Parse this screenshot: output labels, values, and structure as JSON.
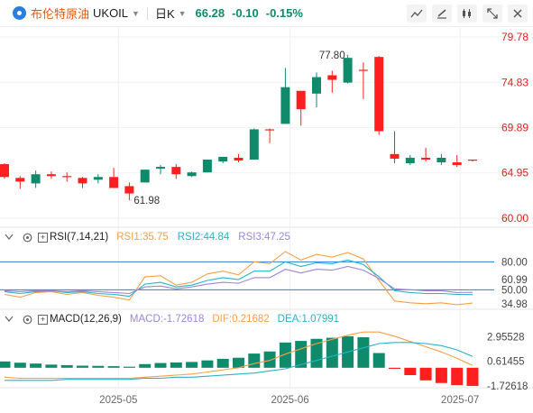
{
  "instrument": {
    "name_cn": "布伦特原油",
    "symbol": "UKOIL",
    "interval": "日K",
    "last_price": "66.28",
    "change": "-0.10",
    "change_pct": "-0.15%"
  },
  "toolbar_icons": [
    "indicator-icon",
    "draw-icon",
    "candle-type-icon",
    "fullscreen-icon",
    "close-icon"
  ],
  "colors": {
    "up": "#0f8a6b",
    "down": "#ff1f1f",
    "rsi1": "#f5a048",
    "rsi2": "#26b3c6",
    "rsi3": "#9b86d8",
    "macd": "#9b86d8",
    "dif": "#f5a048",
    "dea": "#26b3c6",
    "title_accent": "#e8570e"
  },
  "price_axis": {
    "labels": [
      "79.78",
      "74.83",
      "69.89",
      "64.95",
      "60.00"
    ]
  },
  "annotations": {
    "high": "77.80",
    "low": "61.98"
  },
  "rsi": {
    "label": "RSI(7,14,21)",
    "rsi1": "RSI1:35.75",
    "rsi2": "RSI2:44.84",
    "rsi3": "RSI3:47.25",
    "axis_labels": [
      "80.00",
      "60.99",
      "50.00",
      "34.98"
    ]
  },
  "macd": {
    "label": "MACD(12,26,9)",
    "macd": "MACD:-1.72618",
    "dif": "DIF:0.21682",
    "dea": "DEA:1.07991",
    "axis_labels": [
      "2.95528",
      "0.61455",
      "-1.72618"
    ]
  },
  "x_axis": {
    "labels": [
      "2025-05",
      "2025-06",
      "2025-07"
    ]
  },
  "chart_data": [
    {
      "type": "candlestick",
      "title": "UKOIL 日K",
      "ylim": [
        60.0,
        79.78
      ],
      "candles": [
        {
          "o": 65.9,
          "h": 66.0,
          "l": 64.3,
          "c": 64.5
        },
        {
          "o": 64.4,
          "h": 64.6,
          "l": 63.2,
          "c": 64.0
        },
        {
          "o": 63.8,
          "h": 65.2,
          "l": 63.3,
          "c": 64.8
        },
        {
          "o": 64.8,
          "h": 65.1,
          "l": 64.3,
          "c": 64.6
        },
        {
          "o": 64.6,
          "h": 65.0,
          "l": 64.0,
          "c": 64.5
        },
        {
          "o": 64.4,
          "h": 64.5,
          "l": 63.3,
          "c": 63.8
        },
        {
          "o": 64.2,
          "h": 64.8,
          "l": 63.8,
          "c": 64.5
        },
        {
          "o": 64.5,
          "h": 65.5,
          "l": 63.5,
          "c": 63.3
        },
        {
          "o": 63.5,
          "h": 63.9,
          "l": 61.98,
          "c": 62.7
        },
        {
          "o": 63.9,
          "h": 65.3,
          "l": 63.9,
          "c": 65.3
        },
        {
          "o": 65.4,
          "h": 65.8,
          "l": 64.8,
          "c": 65.6
        },
        {
          "o": 65.6,
          "h": 65.9,
          "l": 64.3,
          "c": 64.8
        },
        {
          "o": 64.6,
          "h": 65.1,
          "l": 64.5,
          "c": 65.0
        },
        {
          "o": 65.0,
          "h": 66.4,
          "l": 65.0,
          "c": 66.4
        },
        {
          "o": 66.2,
          "h": 66.7,
          "l": 66.0,
          "c": 66.7
        },
        {
          "o": 66.6,
          "h": 67.0,
          "l": 66.1,
          "c": 66.3
        },
        {
          "o": 66.4,
          "h": 69.8,
          "l": 66.4,
          "c": 69.7
        },
        {
          "o": 69.7,
          "h": 69.8,
          "l": 68.2,
          "c": 69.6
        },
        {
          "o": 70.3,
          "h": 76.4,
          "l": 70.3,
          "c": 74.3
        },
        {
          "o": 73.9,
          "h": 73.9,
          "l": 70.1,
          "c": 71.9
        },
        {
          "o": 73.6,
          "h": 75.9,
          "l": 72.1,
          "c": 75.4
        },
        {
          "o": 75.6,
          "h": 76.1,
          "l": 73.7,
          "c": 75.1
        },
        {
          "o": 74.8,
          "h": 77.8,
          "l": 74.7,
          "c": 77.5
        },
        {
          "o": 76.2,
          "h": 77.0,
          "l": 73.0,
          "c": 76.1
        },
        {
          "o": 77.6,
          "h": 77.7,
          "l": 69.1,
          "c": 69.5
        },
        {
          "o": 67.0,
          "h": 69.5,
          "l": 66.0,
          "c": 66.5
        },
        {
          "o": 66.0,
          "h": 66.9,
          "l": 65.8,
          "c": 66.6
        },
        {
          "o": 66.6,
          "h": 67.7,
          "l": 66.2,
          "c": 66.4
        },
        {
          "o": 66.1,
          "h": 67.0,
          "l": 65.8,
          "c": 66.6
        },
        {
          "o": 66.1,
          "h": 66.9,
          "l": 65.6,
          "c": 65.8
        },
        {
          "o": 66.4,
          "h": 66.4,
          "l": 66.2,
          "c": 66.28
        }
      ]
    },
    {
      "type": "line",
      "title": "RSI(7,14,21)",
      "ylim": [
        30,
        90
      ],
      "reference_lines": [
        80,
        50
      ],
      "series": [
        {
          "name": "RSI1",
          "values": [
            45,
            42,
            47,
            48,
            45,
            47,
            44,
            42,
            39,
            64,
            65,
            55,
            58,
            67,
            70,
            66,
            80,
            78,
            91,
            82,
            88,
            85,
            90,
            83,
            60,
            38,
            36,
            35,
            36,
            34,
            35.75
          ]
        },
        {
          "name": "RSI2",
          "values": [
            48,
            46,
            48,
            49,
            47,
            48,
            46,
            45,
            43,
            56,
            58,
            53,
            55,
            60,
            63,
            61,
            70,
            70,
            80,
            75,
            79,
            78,
            82,
            77,
            64,
            49,
            47,
            46,
            46,
            45,
            44.84
          ]
        },
        {
          "name": "RSI3",
          "values": [
            49,
            48,
            49,
            49,
            48,
            49,
            48,
            47,
            46,
            53,
            54,
            51,
            53,
            56,
            58,
            57,
            63,
            63,
            72,
            68,
            72,
            71,
            75,
            71,
            62,
            51,
            50,
            49,
            49,
            47,
            47.25
          ]
        }
      ]
    },
    {
      "type": "bar",
      "title": "MACD(12,26,9)",
      "ylim": [
        -1.9,
        3.5
      ],
      "macd_bars": [
        0.6,
        0.48,
        0.4,
        0.3,
        0.25,
        0.2,
        0.18,
        0.15,
        0.1,
        0.35,
        0.45,
        0.5,
        0.55,
        0.7,
        0.85,
        0.95,
        1.35,
        1.55,
        2.4,
        2.55,
        2.75,
        2.85,
        3.0,
        2.9,
        1.4,
        -0.1,
        -0.7,
        -1.2,
        -1.45,
        -1.65,
        -1.72618
      ],
      "series": [
        {
          "name": "DIF",
          "values": [
            -0.9,
            -1.0,
            -1.0,
            -1.0,
            -1.0,
            -1.0,
            -1.0,
            -1.0,
            -1.0,
            -0.9,
            -0.8,
            -0.7,
            -0.6,
            -0.4,
            -0.2,
            0.0,
            0.4,
            0.7,
            1.3,
            1.8,
            2.3,
            2.7,
            3.1,
            3.4,
            3.4,
            3.0,
            2.5,
            2.0,
            1.5,
            0.9,
            0.21682
          ]
        },
        {
          "name": "DEA",
          "values": [
            -1.2,
            -1.2,
            -1.2,
            -1.2,
            -1.1,
            -1.1,
            -1.1,
            -1.1,
            -1.1,
            -1.0,
            -1.0,
            -0.9,
            -0.9,
            -0.8,
            -0.7,
            -0.6,
            -0.5,
            -0.3,
            -0.1,
            0.3,
            0.7,
            1.1,
            1.5,
            1.9,
            2.3,
            2.4,
            2.4,
            2.3,
            2.1,
            1.7,
            1.07991
          ]
        }
      ]
    }
  ]
}
